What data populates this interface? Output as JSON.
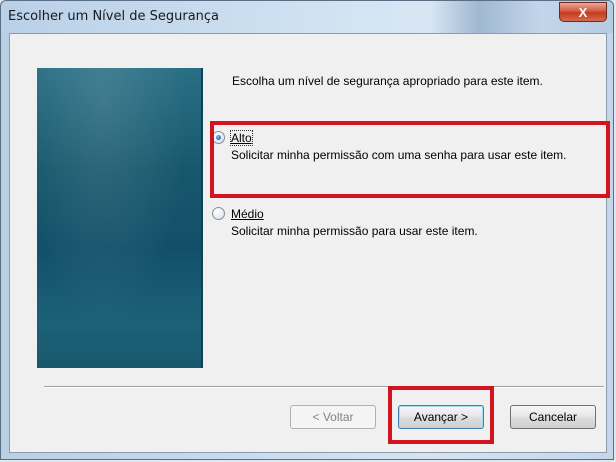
{
  "window": {
    "title": "Escolher um Nível de Segurança",
    "close_label": "X"
  },
  "content": {
    "prompt": "Escolha um nível de segurança apropriado para este item.",
    "options": [
      {
        "label": "Alto",
        "description": "Solicitar minha permissão com uma senha para usar este item.",
        "selected": true
      },
      {
        "label": "Médio",
        "description": "Solicitar minha permissão para usar este item.",
        "selected": false
      }
    ]
  },
  "buttons": {
    "back": "< Voltar",
    "next": "Avançar >",
    "cancel": "Cancelar"
  },
  "colors": {
    "highlight": "#d4141c",
    "side_image": "#17576c"
  }
}
